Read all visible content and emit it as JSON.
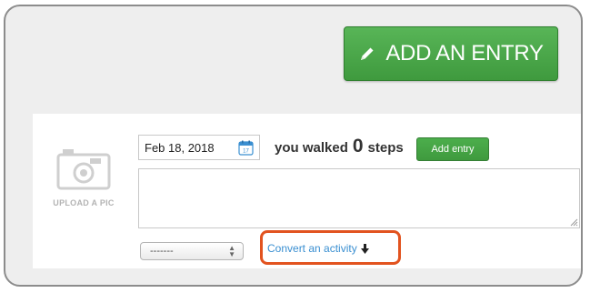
{
  "header": {
    "add_entry_label": "ADD AN ENTRY"
  },
  "entry": {
    "upload_label": "UPLOAD A PIC",
    "date_value": "Feb 18, 2018",
    "walked_prefix": "you walked",
    "steps_count": "0",
    "steps_suffix": "steps",
    "add_entry_small_label": "Add entry",
    "notes_value": "",
    "activity_select_value": "-------",
    "convert_link_label": "Convert an activity"
  },
  "colors": {
    "primary_green": "#4cae4c",
    "highlight_orange": "#e2531f",
    "link_blue": "#3a8fd1"
  },
  "icons": {
    "add_entry": "pencil-icon",
    "upload": "camera-icon",
    "date": "calendar-icon",
    "convert": "arrow-down-icon"
  }
}
